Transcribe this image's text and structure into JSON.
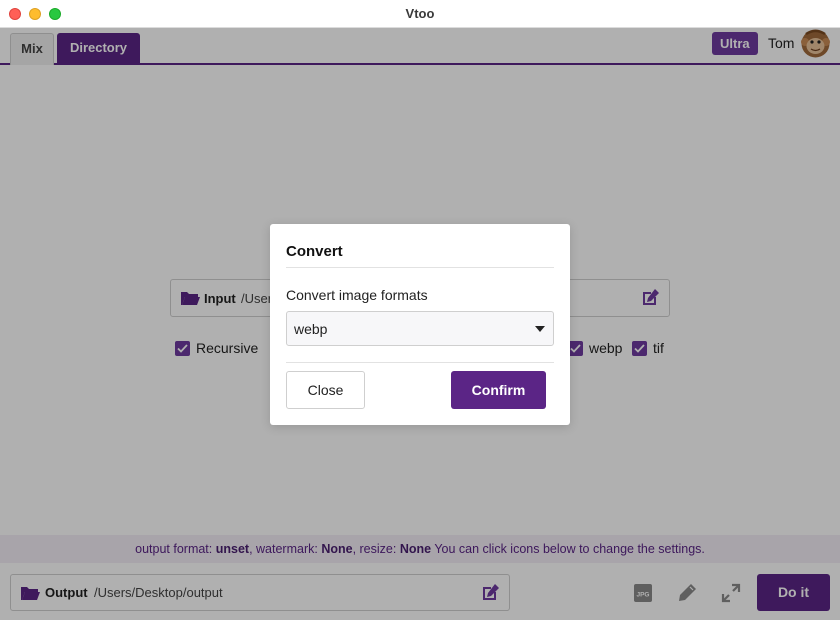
{
  "window": {
    "title": "Vtoo"
  },
  "tabs": [
    {
      "label": "Mix",
      "active": false
    },
    {
      "label": "Directory",
      "active": true
    }
  ],
  "account": {
    "plan_badge": "Ultra",
    "username": "Tom",
    "avatar_icon": "monkey-avatar-icon"
  },
  "main": {
    "input": {
      "label": "Input",
      "path": "/User",
      "folder_icon": "folder-open-icon",
      "edit_icon": "edit-icon"
    },
    "options": [
      {
        "label": "Recursive",
        "checked": true
      },
      {
        "label": "webp",
        "checked": true
      },
      {
        "label": "tif",
        "checked": true
      }
    ]
  },
  "settings_bar": {
    "format_prefix": "output format: ",
    "format_value": "unset",
    "watermark_prefix": ", watermark: ",
    "watermark_value": "None",
    "resize_prefix": ", resize: ",
    "resize_value": "None",
    "hint": " You can click icons below to change the settings."
  },
  "bottom": {
    "output": {
      "label": "Output",
      "path": "/Users/Desktop/output",
      "folder_icon": "folder-open-icon",
      "edit_icon": "edit-icon"
    },
    "tools": [
      "jpg-format-icon",
      "pencil-icon",
      "resize-arrows-icon"
    ],
    "run_label": "Do it"
  },
  "modal": {
    "title": "Convert",
    "label": "Convert image formats",
    "selected": "webp",
    "close_label": "Close",
    "confirm_label": "Confirm"
  },
  "colors": {
    "accent": "#5b2586",
    "accent_light": "#6e3aa0",
    "overlay": "rgba(0,0,0,0.31)"
  }
}
